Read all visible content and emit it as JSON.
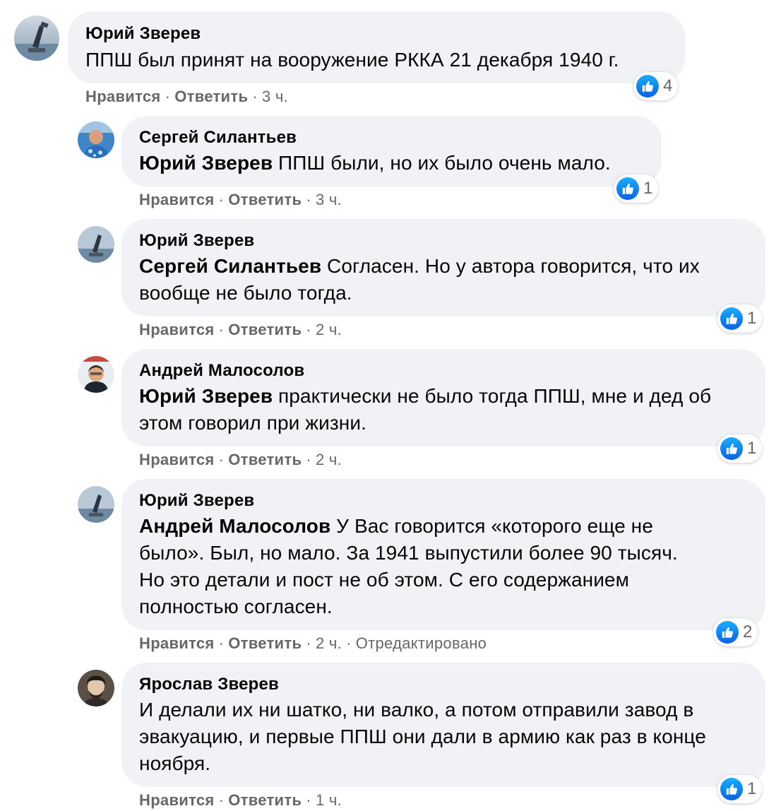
{
  "colors": {
    "bubble": "#f0f2f5",
    "meta_text": "#65676b",
    "like_blue": "#1877f2"
  },
  "icons": {
    "like": "thumbs-up-icon"
  },
  "comments": [
    {
      "author": "Юрий Зверев",
      "mention": "",
      "text": "ППШ был принят на вооружение РККА 21 декабря 1940 г.",
      "like_label": "Нравится",
      "reply_label": "Ответить",
      "time": "3 ч.",
      "edited": "",
      "reactions": "4"
    },
    {
      "author": "Сергей Силантьев",
      "mention": "Юрий Зверев",
      "text": "ППШ были, но их было очень мало.",
      "like_label": "Нравится",
      "reply_label": "Ответить",
      "time": "3 ч.",
      "edited": "",
      "reactions": "1"
    },
    {
      "author": "Юрий Зверев",
      "mention": "Сергей Силантьев",
      "text": "Согласен. Но у автора говорится, что их вообще не было тогда.",
      "like_label": "Нравится",
      "reply_label": "Ответить",
      "time": "2 ч.",
      "edited": "",
      "reactions": "1"
    },
    {
      "author": "Андрей Малосолов",
      "mention": "Юрий Зверев",
      "text": "практически не было тогда ППШ, мне и дед об этом говорил при жизни.",
      "like_label": "Нравится",
      "reply_label": "Ответить",
      "time": "2 ч.",
      "edited": "",
      "reactions": "1"
    },
    {
      "author": "Юрий Зверев",
      "mention": "Андрей Малосолов",
      "text": "У Вас говорится «которого еще не было». Был, но мало. За 1941 выпустили более 90 тысяч. Но это детали и пост не об этом. С его содержанием полностью согласен.",
      "like_label": "Нравится",
      "reply_label": "Ответить",
      "time": "2 ч.",
      "edited": "Отредактировано",
      "reactions": "2"
    },
    {
      "author": "Ярослав Зверев",
      "mention": "",
      "text": "И делали их ни шатко, ни валко, а потом отправили завод в эвакуацию, и первые ППШ они дали в армию как раз в конце ноября.",
      "like_label": "Нравится",
      "reply_label": "Ответить",
      "time": "1 ч.",
      "edited": "",
      "reactions": "1"
    }
  ]
}
